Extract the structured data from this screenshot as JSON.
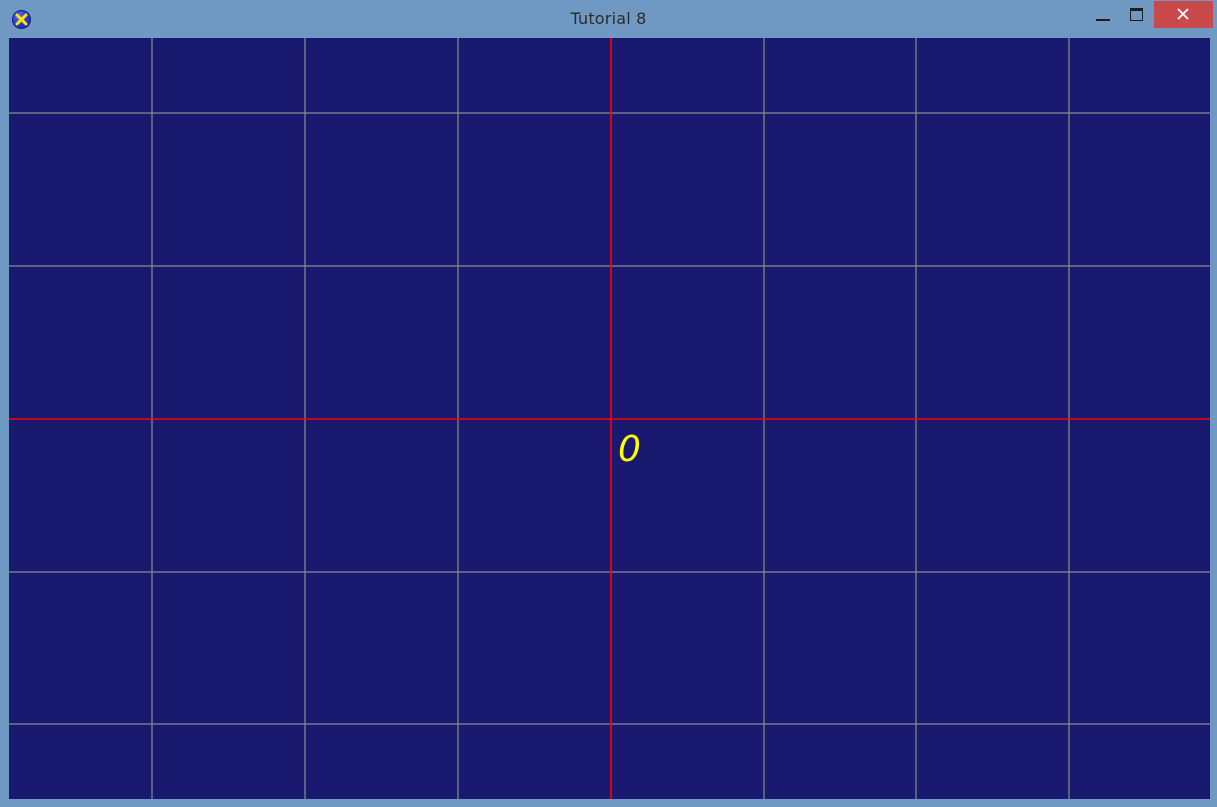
{
  "window": {
    "title": "Tutorial 8",
    "icon": "app-icon",
    "controls": {
      "minimize": "minimize-icon",
      "maximize": "maximize-icon",
      "close": "close-icon"
    }
  },
  "canvas": {
    "background_color": "#191970",
    "grid_color": "#8c8c8c",
    "axis_color": "#ff0000",
    "origin_label": "0",
    "origin_label_color": "#ffff00"
  }
}
